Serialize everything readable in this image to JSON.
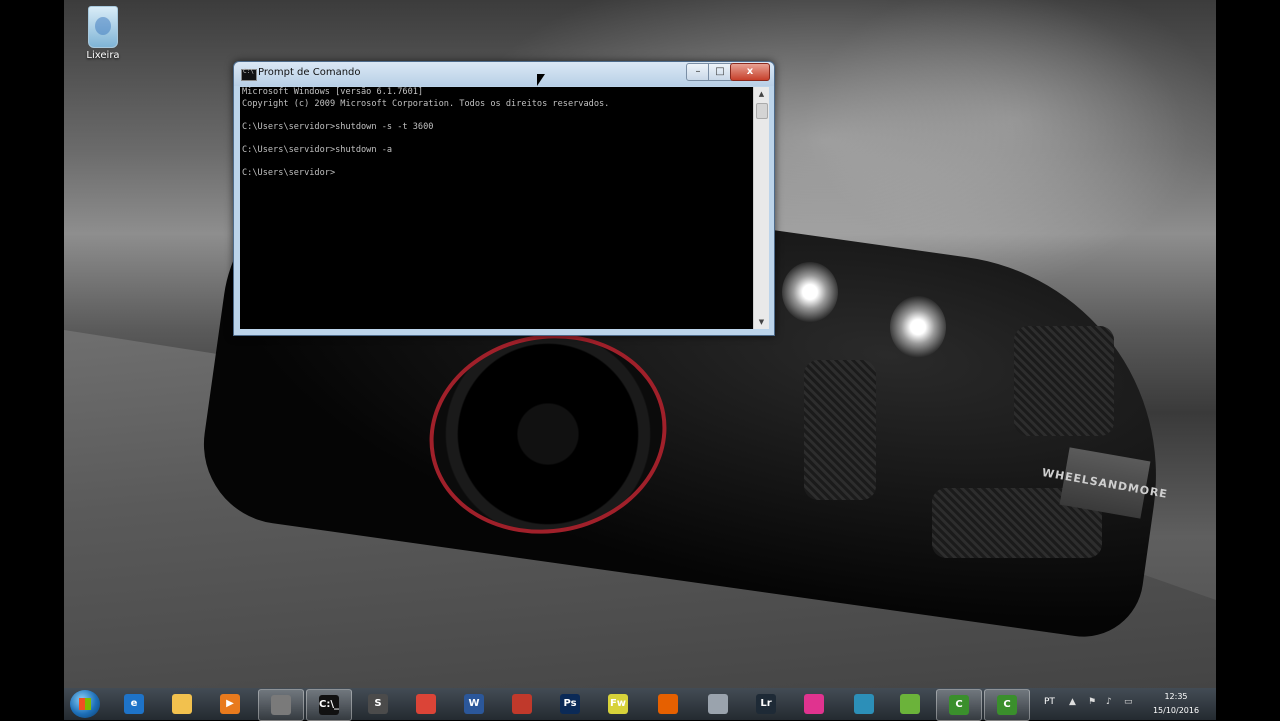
{
  "desktop": {
    "icons": [
      {
        "label": "Lixeira",
        "icon": "recycle-bin-icon"
      }
    ],
    "wallpaper_badge": "WHEELSANDMORE"
  },
  "window": {
    "title": "Prompt de Comando",
    "buttons": {
      "minimize": "–",
      "maximize": "□",
      "close": "x"
    },
    "console_lines": [
      "Microsoft Windows [versão 6.1.7601]",
      "Copyright (c) 2009 Microsoft Corporation. Todos os direitos reservados.",
      "",
      "C:\\Users\\servidor>shutdown -s -t 3600",
      "",
      "C:\\Users\\servidor>shutdown -a",
      "",
      "C:\\Users\\servidor>"
    ]
  },
  "taskbar": {
    "apps": [
      {
        "name": "internet-explorer",
        "glyph": "e",
        "color": "#1e73c8",
        "active": false
      },
      {
        "name": "windows-explorer",
        "glyph": "",
        "color": "#f2c14e",
        "active": false
      },
      {
        "name": "media-player",
        "glyph": "▶",
        "color": "#e87a1d",
        "active": false
      },
      {
        "name": "task-manager",
        "glyph": "",
        "color": "#7a7a7a",
        "active": true
      },
      {
        "name": "command-prompt",
        "glyph": "C:\\_",
        "color": "#111111",
        "active": true
      },
      {
        "name": "sublime-text",
        "glyph": "S",
        "color": "#4b4b4b",
        "active": false
      },
      {
        "name": "chrome",
        "glyph": "",
        "color": "#db4437",
        "active": false
      },
      {
        "name": "word",
        "glyph": "W",
        "color": "#2b579a",
        "active": false
      },
      {
        "name": "red-app",
        "glyph": "",
        "color": "#c0392b",
        "active": false
      },
      {
        "name": "photoshop",
        "glyph": "Ps",
        "color": "#0b2a57",
        "active": false
      },
      {
        "name": "fireworks",
        "glyph": "Fw",
        "color": "#d7d23a",
        "active": false
      },
      {
        "name": "firefox",
        "glyph": "",
        "color": "#e66000",
        "active": false
      },
      {
        "name": "app-icon",
        "glyph": "",
        "color": "#9aa3ad",
        "active": false
      },
      {
        "name": "lightroom",
        "glyph": "Lr",
        "color": "#1e2a36",
        "active": false
      },
      {
        "name": "pink-app",
        "glyph": "",
        "color": "#e0338f",
        "active": false
      },
      {
        "name": "film-app",
        "glyph": "",
        "color": "#2c8fb8",
        "active": false
      },
      {
        "name": "chart-app",
        "glyph": "",
        "color": "#6bb33a",
        "active": false
      },
      {
        "name": "camtasia",
        "glyph": "C",
        "color": "#3a8f2c",
        "active": true
      },
      {
        "name": "camtasia-recorder",
        "glyph": "C",
        "color": "#3a8f2c",
        "active": true
      }
    ],
    "tray": {
      "language": "PT",
      "time": "12:35",
      "date": "15/10/2016"
    }
  }
}
